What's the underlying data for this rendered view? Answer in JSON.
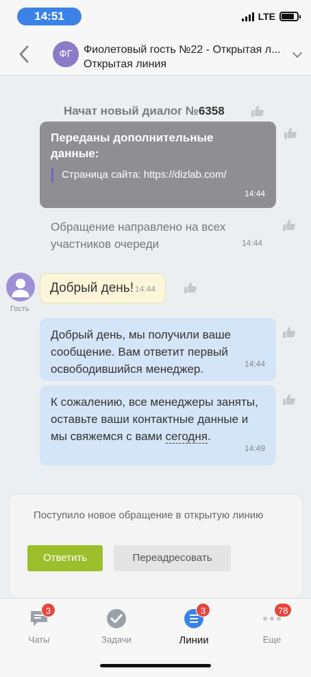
{
  "status_bar": {
    "time": "14:51",
    "network": "LTE",
    "battery_level": 0.8
  },
  "header": {
    "avatar_initials": "ФГ",
    "title": "Фиолетовый гость №22 - Открытая л...",
    "subtitle": "Открытая линия"
  },
  "chat": {
    "system_title_prefix": "Начат новый диалог №",
    "system_title_number": "6358",
    "info_card": {
      "title": "Переданы дополнительные данные:",
      "quote": "Страница сайта: https://dizlab.com/",
      "time": "14:44"
    },
    "system_message": {
      "text": "Обращение направлено на всех участников очереди",
      "time": "14:44"
    },
    "guest": {
      "label": "Гость",
      "text": "Добрый день!",
      "time": "14:44"
    },
    "bot_messages": [
      {
        "text": "Добрый день, мы получили ваше сообщение. Вам ответит первый освободившийся менеджер.",
        "time": "14:44"
      },
      {
        "text_main": "К сожалению, все менеджеры заняты, оставьте ваши контактные данные и мы свяжемся с вами ",
        "text_link": "сегодня",
        "text_end": ".",
        "time": "14:49"
      }
    ]
  },
  "notification": {
    "text": "Поступило новое обращение в открытую линию",
    "answer_label": "Ответить",
    "forward_label": "Переадресовать"
  },
  "tabs": [
    {
      "label": "Чаты",
      "badge": "3",
      "icon": "chat-icon"
    },
    {
      "label": "Задачи",
      "badge": "",
      "icon": "check-icon"
    },
    {
      "label": "Линии",
      "badge": "3",
      "icon": "lines-icon",
      "active": true
    },
    {
      "label": "Еще",
      "badge": "78",
      "icon": "more-icon"
    }
  ],
  "colors": {
    "accent": "#3b82e8",
    "answer": "#9cbf2b",
    "badge": "#e5463c",
    "guest_bubble": "#fbf6d9",
    "bot_bubble": "#d4e5f7"
  }
}
